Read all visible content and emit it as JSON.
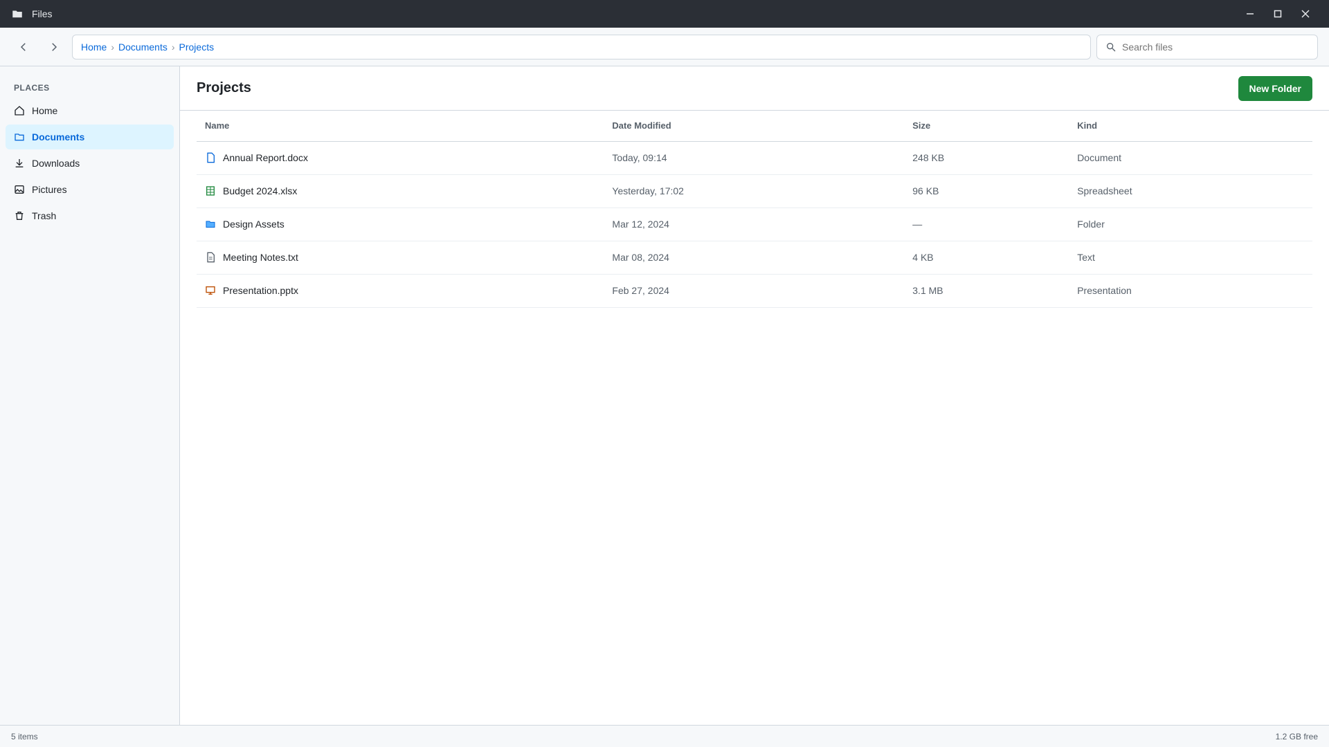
{
  "window": {
    "title": "Files"
  },
  "toolbar": {
    "breadcrumb": [
      "Home",
      "Documents",
      "Projects"
    ],
    "search_placeholder": "Search files"
  },
  "sidebar": {
    "heading": "Places",
    "items": [
      {
        "label": "Home",
        "icon": "home-icon",
        "active": false
      },
      {
        "label": "Documents",
        "icon": "folder-icon",
        "active": true
      },
      {
        "label": "Downloads",
        "icon": "download-icon",
        "active": false
      },
      {
        "label": "Pictures",
        "icon": "image-icon",
        "active": false
      },
      {
        "label": "Trash",
        "icon": "trash-icon",
        "active": false
      }
    ]
  },
  "main": {
    "title": "Projects",
    "new_button_label": "New Folder",
    "columns": [
      "Name",
      "Date Modified",
      "Size",
      "Kind"
    ],
    "rows": [
      {
        "name": "Annual Report.docx",
        "modified": "Today, 09:14",
        "size": "248 KB",
        "kind": "Document"
      },
      {
        "name": "Budget 2024.xlsx",
        "modified": "Yesterday, 17:02",
        "size": "96 KB",
        "kind": "Spreadsheet"
      },
      {
        "name": "Design Assets",
        "modified": "Mar 12, 2024",
        "size": "—",
        "kind": "Folder"
      },
      {
        "name": "Meeting Notes.txt",
        "modified": "Mar 08, 2024",
        "size": "4 KB",
        "kind": "Text"
      },
      {
        "name": "Presentation.pptx",
        "modified": "Feb 27, 2024",
        "size": "3.1 MB",
        "kind": "Presentation"
      }
    ]
  },
  "statusbar": {
    "left": "5 items",
    "right": "1.2 GB free"
  },
  "colors": {
    "accent": "#0969da",
    "primary": "#1f883d",
    "titlebar": "#2b2f36"
  }
}
